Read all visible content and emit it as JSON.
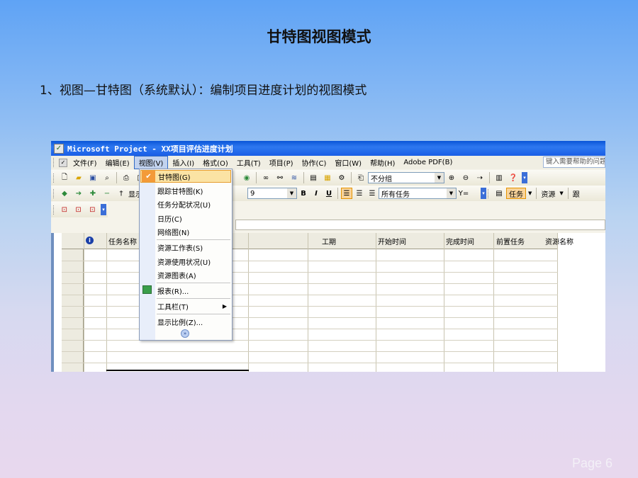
{
  "slide": {
    "title": "甘特图视图模式",
    "subtitle": "1、视图—甘特图（系统默认）：编制项目进度计划的视图模式",
    "page": "Page 6"
  },
  "window": {
    "title": "Microsoft Project - XX项目评估进度计划",
    "help_placeholder": "键入需要帮助的问题"
  },
  "menubar": {
    "items": [
      "文件(F)",
      "编辑(E)",
      "视图(V)",
      "插入(I)",
      "格式(O)",
      "工具(T)",
      "项目(P)",
      "协作(C)",
      "窗口(W)",
      "帮助(H)",
      "Adobe PDF(B)"
    ],
    "active_index": 2
  },
  "toolbar1": {
    "group_value": "不分组"
  },
  "toolbar2": {
    "show_label": "显示",
    "font_size": "9",
    "filter_value": "所有任务",
    "task_label": "任务",
    "resource_label": "资源",
    "more_label": "跟"
  },
  "grid": {
    "columns": [
      "任务名称",
      "工期",
      "开始时间",
      "完成时间",
      "前置任务",
      "资源名称"
    ]
  },
  "view_menu": {
    "items": [
      {
        "label": "甘特图(G)",
        "checked": true
      },
      {
        "label": "跟踪甘特图(K)"
      },
      {
        "label": "任务分配状况(U)"
      },
      {
        "label": "日历(C)"
      },
      {
        "label": "网络图(N)"
      },
      {
        "label": "资源工作表(S)"
      },
      {
        "label": "资源使用状况(U)"
      },
      {
        "label": "资源图表(A)"
      },
      {
        "label": "报表(R)..."
      },
      {
        "label": "工具栏(T)"
      },
      {
        "label": "显示比例(Z)..."
      }
    ]
  },
  "colors": {
    "titlebar": "#1a5ee6",
    "menu_highlight": "#fbe3a4",
    "check_bg": "#f39a38"
  }
}
